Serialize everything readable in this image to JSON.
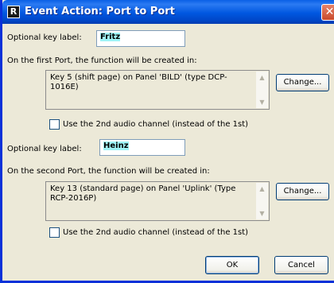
{
  "window": {
    "title": "Event Action: Port to Port",
    "close_glyph": "✕",
    "app_icon_glyph": "R"
  },
  "port1": {
    "key_label_caption": "Optional key label:",
    "key_label_value": "Fritz",
    "location_caption": "On the first Port, the function will be created in:",
    "location_text": "Key 5 (shift page) on Panel 'BILD' (type DCP-1016E)",
    "change_label": "Change...",
    "audio_checkbox_label": "Use the 2nd audio channel (instead of the 1st)",
    "audio_checked": false
  },
  "port2": {
    "key_label_caption": "Optional key label:",
    "key_label_value": "Heinz",
    "location_caption": "On the second Port, the function will be created in:",
    "location_text": "Key 13 (standard page) on Panel 'Uplink' (Type RCP-2016P)",
    "change_label": "Change...",
    "audio_checkbox_label": "Use the 2nd audio channel (instead of the 1st)",
    "audio_checked": false
  },
  "footer": {
    "ok_label": "OK",
    "cancel_label": "Cancel"
  },
  "icons": {
    "scroll_up": "▲",
    "scroll_down": "▼"
  }
}
